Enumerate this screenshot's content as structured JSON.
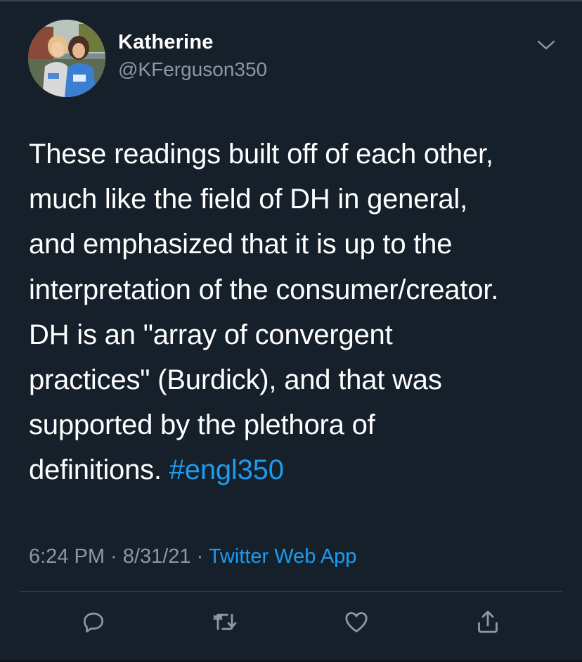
{
  "tweet": {
    "author": {
      "display_name": "Katherine",
      "handle": "@KFerguson350"
    },
    "text_lines": [
      "These readings built off of each other,",
      "much like the field of DH in general,",
      "and emphasized that it is up to the",
      "interpretation of the consumer/creator.",
      "DH is an \"array of convergent",
      "practices\" (Burdick), and that was",
      "supported by the plethora of",
      "definitions. "
    ],
    "hashtag": "#engl350",
    "time": "6:24 PM",
    "separator": " · ",
    "date": "8/31/21",
    "source": "Twitter Web App"
  },
  "actions": {
    "reply_icon": "reply-icon",
    "retweet_icon": "retweet-icon",
    "like_icon": "like-icon",
    "share_icon": "share-icon"
  },
  "colors": {
    "background": "#15202b",
    "text": "#ffffff",
    "secondary_text": "#8b98a5",
    "accent": "#1d9bf0",
    "divider": "#38444d"
  }
}
